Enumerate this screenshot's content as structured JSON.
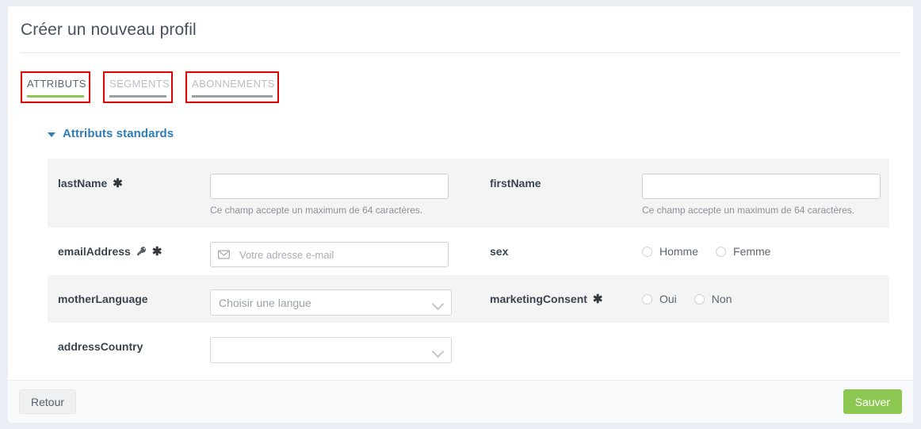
{
  "page": {
    "title": "Créer un nouveau profil"
  },
  "tabs": [
    {
      "label": "ATTRIBUTS",
      "state": "active",
      "underline_color": "#8cc751",
      "annotated": true
    },
    {
      "label": "SEGMENTS",
      "state": "inactive",
      "underline_color": "#9aa1a9",
      "annotated": true
    },
    {
      "label": "ABONNEMENTS",
      "state": "inactive",
      "underline_color": "#9aa1a9",
      "annotated": true
    }
  ],
  "section": {
    "title": "Attributs standards",
    "expanded": true,
    "caret_icon": "caret-down-icon",
    "color": "#2e7cb8"
  },
  "fields": {
    "last_name": {
      "label": "lastName",
      "required_marker": "✱",
      "value": "",
      "placeholder": "",
      "help": "Ce champ accepte un maximum de 64 caractères."
    },
    "first_name": {
      "label": "firstName",
      "value": "",
      "placeholder": "",
      "help": "Ce champ accepte un maximum de 64 caractères."
    },
    "email_address": {
      "label": "emailAddress",
      "key_marker": "🔑",
      "required_marker": "✱",
      "value": "",
      "placeholder": "Votre adresse e-mail",
      "icon": "envelope-icon"
    },
    "sex": {
      "label": "sex",
      "options": [
        {
          "label": "Homme",
          "selected": false
        },
        {
          "label": "Femme",
          "selected": false
        }
      ]
    },
    "mother_language": {
      "label": "motherLanguage",
      "selected": "Choisir une langue",
      "chevron_icon": "chevron-down-icon"
    },
    "marketing_consent": {
      "label": "marketingConsent",
      "required_marker": "✱",
      "options": [
        {
          "label": "Oui",
          "selected": false
        },
        {
          "label": "Non",
          "selected": false
        }
      ]
    },
    "address_country": {
      "label": "addressCountry",
      "selected": "",
      "chevron_icon": "chevron-down-icon"
    }
  },
  "footer": {
    "back_label": "Retour",
    "save_label": "Sauver",
    "save_color": "#8cc751"
  },
  "annotation": {
    "box_color": "#e10000"
  }
}
